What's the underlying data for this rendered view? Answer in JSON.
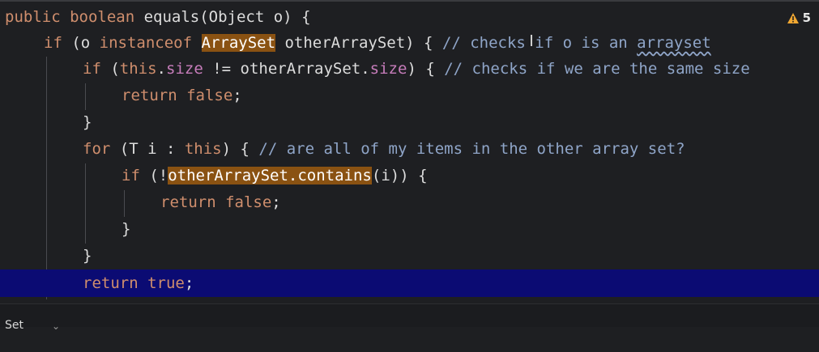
{
  "editor": {
    "warning_count": "5",
    "lines": [
      {
        "t1": "public boolean ",
        "t2": "equals",
        "t3": "(Object o) {"
      },
      {
        "kw": "if",
        "t1": " (o ",
        "kw2": "instanceof",
        "sp": " ",
        "hl": "ArraySet",
        "t2": " otherArraySet) { ",
        "c1": "// checks if o is an ",
        "c2": "arrayset"
      },
      {
        "kw": "if",
        "t1": " (",
        "kw2": "this",
        "t2": ".",
        "f1": "size",
        "t3": " != otherArraySet.",
        "f2": "size",
        "t4": ") { ",
        "c1": "// checks if we are the same size"
      },
      {
        "kw": "return false",
        "t1": ";"
      },
      {
        "t1": "}"
      },
      {
        "kw": "for",
        "t1": " (T i : ",
        "kw2": "this",
        "t2": ") { ",
        "c1": "// are all of my items in the other array set?"
      },
      {
        "kw": "if",
        "t1": " (!",
        "hl": "otherArraySet.contains",
        "t2": "(i)) {"
      },
      {
        "kw": "return false",
        "t1": ";"
      },
      {
        "t1": "}"
      },
      {
        "t1": "}"
      },
      {
        "kw": "return true",
        "t1": ";"
      }
    ]
  },
  "bottom": {
    "text": "Set",
    "chevron": "⌄"
  }
}
